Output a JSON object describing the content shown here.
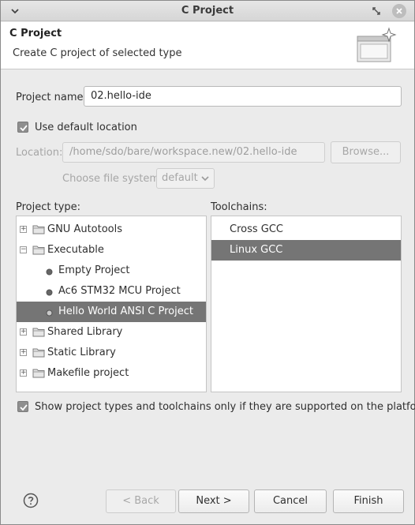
{
  "window": {
    "title": "C Project"
  },
  "header": {
    "title": "C Project",
    "subtitle": "Create C project of selected type"
  },
  "form": {
    "project_name_label": "Project name:",
    "project_name_value": "02.hello-ide",
    "use_default_location_label": "Use default location",
    "use_default_location_checked": true,
    "location_label": "Location:",
    "location_value": "/home/sdo/bare/workspace.new/02.hello-ide",
    "browse_label": "Browse...",
    "file_system_label": "Choose file system:",
    "file_system_value": "default"
  },
  "project_type": {
    "label": "Project type:",
    "items": [
      {
        "label": "GNU Autotools",
        "kind": "folder",
        "expander": "+"
      },
      {
        "label": "Executable",
        "kind": "folder",
        "expander": "−"
      },
      {
        "label": "Empty Project",
        "kind": "child"
      },
      {
        "label": "Ac6 STM32 MCU Project",
        "kind": "child"
      },
      {
        "label": "Hello World ANSI C Project",
        "kind": "child",
        "selected": true
      },
      {
        "label": "Shared Library",
        "kind": "folder",
        "expander": "+"
      },
      {
        "label": "Static Library",
        "kind": "folder",
        "expander": "+"
      },
      {
        "label": "Makefile project",
        "kind": "folder",
        "expander": "+"
      }
    ]
  },
  "toolchains": {
    "label": "Toolchains:",
    "items": [
      {
        "label": "Cross GCC"
      },
      {
        "label": "Linux GCC",
        "selected": true
      }
    ]
  },
  "filter": {
    "label": "Show project types and toolchains only if they are supported on the platform",
    "checked": true
  },
  "buttons": {
    "back": "< Back",
    "next": "Next >",
    "cancel": "Cancel",
    "finish": "Finish"
  },
  "icons": {
    "help": "help-icon",
    "folder": "folder-icon",
    "bullet": "bullet-icon"
  },
  "colors": {
    "selection": "#757575",
    "checkbox": "#8f8f8f"
  }
}
